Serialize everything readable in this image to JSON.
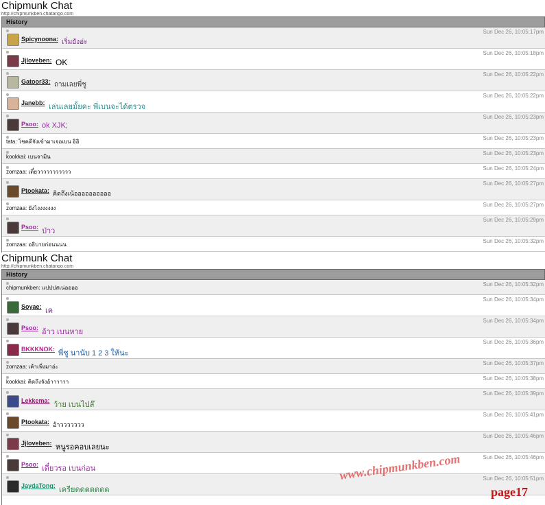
{
  "screens": [
    {
      "title": "Chipmunk Chat",
      "url": "http://chipmunkben.chatango.com",
      "history_label": "History",
      "messages": [
        {
          "type": "user",
          "name": "Spicynoona:",
          "name_color": "#1a1a1a",
          "text": "เริ่มยังอ่ะ",
          "text_color": "#7a2a8a",
          "text_size": 10,
          "avatar": "#c9a34a",
          "time": "Sun Dec 26, 10:05:17pm"
        },
        {
          "type": "user",
          "name": "Jjloveben:",
          "name_color": "#1a1a1a",
          "text": "OK",
          "text_color": "#000000",
          "text_size": 12,
          "avatar": "#7a3a4a",
          "time": "Sun Dec 26, 10:05:18pm"
        },
        {
          "type": "user",
          "name": "Gatoor33:",
          "name_color": "#1a1a1a",
          "text": "ถามเลยพี่ชู",
          "text_color": "#3a3a3a",
          "text_size": 10,
          "avatar": "#b8b8a0",
          "time": "Sun Dec 26, 10:05:22pm"
        },
        {
          "type": "user",
          "name": "Janebb:",
          "name_color": "#1a1a1a",
          "text": "เล่นเลยมั้ยคะ พี่เบนจะได้ตรวจ",
          "text_color": "#2a8a8a",
          "text_size": 11,
          "avatar": "#d9b29a",
          "time": "Sun Dec 26, 10:05:22pm"
        },
        {
          "type": "user",
          "name": "Psoo:",
          "name_color": "#9a2aa0",
          "text": "ok XJK;",
          "text_color": "#9a2aa0",
          "text_size": 11,
          "avatar": "#4a3a3a",
          "time": "Sun Dec 26, 10:05:23pm"
        },
        {
          "type": "plain",
          "line": "tata: โชคดีจังเข้ามาเจอเบน อิอิ",
          "time": "Sun Dec 26, 10:05:23pm"
        },
        {
          "type": "plain",
          "line": "kookkai: เบนจามิน",
          "time": "Sun Dec 26, 10:05:23pm"
        },
        {
          "type": "plain",
          "line": "zomzaa: เดี๋ยววววววววววว",
          "time": "Sun Dec 26, 10:05:24pm"
        },
        {
          "type": "user",
          "name": "Ptookata:",
          "name_color": "#1a1a1a",
          "text": "คิดถึงเน้ออออออออออ",
          "text_color": "#111111",
          "text_size": 9,
          "avatar": "#6a4a2a",
          "time": "Sun Dec 26, 10:05:27pm"
        },
        {
          "type": "plain",
          "line": "zomzaa: ยังไงงงงงงง",
          "time": "Sun Dec 26, 10:05:27pm"
        },
        {
          "type": "user",
          "name": "Psoo:",
          "name_color": "#9a2aa0",
          "text": "ป่าว",
          "text_color": "#9a2aa0",
          "text_size": 11,
          "avatar": "#4a3a3a",
          "time": "Sun Dec 26, 10:05:29pm"
        },
        {
          "type": "plain",
          "line": "zomzaa: อธิบายก่อนนนน",
          "time": "Sun Dec 26, 10:05:32pm"
        }
      ]
    },
    {
      "title": "Chipmunk Chat",
      "url": "http://chipmunkben.chatango.com",
      "history_label": "History",
      "messages": [
        {
          "type": "plain",
          "line": "chipmunkben: แปปปสเน่ออออ",
          "time": "Sun Dec 26, 10:05:32pm"
        },
        {
          "type": "user",
          "name": "Soyae:",
          "name_color": "#1a1a1a",
          "text": "เค",
          "text_color": "#7a2aa0",
          "text_size": 11,
          "avatar": "#3a6a3a",
          "time": "Sun Dec 26, 10:05:34pm"
        },
        {
          "type": "user",
          "name": "Psoo:",
          "name_color": "#9a2aa0",
          "text": "อ้าว เบนหาย",
          "text_color": "#9a2aa0",
          "text_size": 11,
          "avatar": "#4a3a3a",
          "time": "Sun Dec 26, 10:05:34pm"
        },
        {
          "type": "user",
          "name": "BKKKNOK:",
          "name_color": "#b0208a",
          "text": "พี่ชู นานับ 1 2 3 ให้นะ",
          "text_color": "#1a5aa0",
          "text_size": 11,
          "avatar": "#8a2a4a",
          "time": "Sun Dec 26, 10:05:36pm"
        },
        {
          "type": "plain",
          "line": "zomzaa: เค้าเพิ่งมาอ่ะ",
          "time": "Sun Dec 26, 10:05:37pm"
        },
        {
          "type": "plain",
          "line": "kookkai: คิดถึงจังอ้าาาาาา",
          "time": "Sun Dec 26, 10:05:38pm"
        },
        {
          "type": "user",
          "name": "Lekkema:",
          "name_color": "#8a1a6a",
          "text": "ว้าย เบนไปล๊",
          "text_color": "#3a7a2a",
          "text_size": 11,
          "avatar": "#3a4a8a",
          "time": "Sun Dec 26, 10:05:39pm"
        },
        {
          "type": "user",
          "name": "Ptookata:",
          "name_color": "#1a1a1a",
          "text": "อ้าววววววว",
          "text_color": "#111111",
          "text_size": 9,
          "avatar": "#6a4a2a",
          "time": "Sun Dec 26, 10:05:41pm"
        },
        {
          "type": "user",
          "name": "Jjloveben:",
          "name_color": "#1a1a1a",
          "text": "หนูรอคอบเลยนะ",
          "text_color": "#000000",
          "text_size": 11,
          "avatar": "#7a3a4a",
          "time": "Sun Dec 26, 10:05:46pm"
        },
        {
          "type": "user",
          "name": "Psoo:",
          "name_color": "#9a2aa0",
          "text": "เดี๋ยวรอ เบนก่อน",
          "text_color": "#9a2aa0",
          "text_size": 11,
          "avatar": "#4a3a3a",
          "time": "Sun Dec 26, 10:05:46pm"
        },
        {
          "type": "user",
          "name": "JaydaTong:",
          "name_color": "#1a8a6a",
          "text": "เครียดดดดดดด",
          "text_color": "#2a8a4a",
          "text_size": 11,
          "avatar": "#2a2a2a",
          "time": "Sun Dec 26, 10:05:51pm"
        }
      ]
    }
  ],
  "watermark": "www.chipmunkben.com",
  "page_label": "page17"
}
